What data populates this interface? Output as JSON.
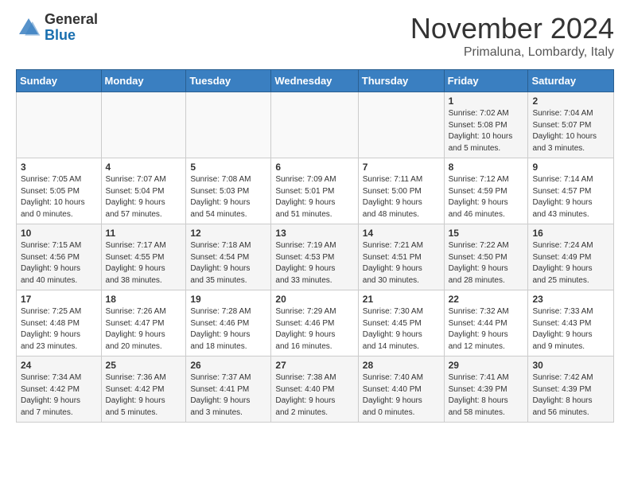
{
  "header": {
    "logo_general": "General",
    "logo_blue": "Blue",
    "month_year": "November 2024",
    "location": "Primaluna, Lombardy, Italy"
  },
  "weekdays": [
    "Sunday",
    "Monday",
    "Tuesday",
    "Wednesday",
    "Thursday",
    "Friday",
    "Saturday"
  ],
  "weeks": [
    [
      {
        "day": "",
        "info": ""
      },
      {
        "day": "",
        "info": ""
      },
      {
        "day": "",
        "info": ""
      },
      {
        "day": "",
        "info": ""
      },
      {
        "day": "",
        "info": ""
      },
      {
        "day": "1",
        "info": "Sunrise: 7:02 AM\nSunset: 5:08 PM\nDaylight: 10 hours\nand 5 minutes."
      },
      {
        "day": "2",
        "info": "Sunrise: 7:04 AM\nSunset: 5:07 PM\nDaylight: 10 hours\nand 3 minutes."
      }
    ],
    [
      {
        "day": "3",
        "info": "Sunrise: 7:05 AM\nSunset: 5:05 PM\nDaylight: 10 hours\nand 0 minutes."
      },
      {
        "day": "4",
        "info": "Sunrise: 7:07 AM\nSunset: 5:04 PM\nDaylight: 9 hours\nand 57 minutes."
      },
      {
        "day": "5",
        "info": "Sunrise: 7:08 AM\nSunset: 5:03 PM\nDaylight: 9 hours\nand 54 minutes."
      },
      {
        "day": "6",
        "info": "Sunrise: 7:09 AM\nSunset: 5:01 PM\nDaylight: 9 hours\nand 51 minutes."
      },
      {
        "day": "7",
        "info": "Sunrise: 7:11 AM\nSunset: 5:00 PM\nDaylight: 9 hours\nand 48 minutes."
      },
      {
        "day": "8",
        "info": "Sunrise: 7:12 AM\nSunset: 4:59 PM\nDaylight: 9 hours\nand 46 minutes."
      },
      {
        "day": "9",
        "info": "Sunrise: 7:14 AM\nSunset: 4:57 PM\nDaylight: 9 hours\nand 43 minutes."
      }
    ],
    [
      {
        "day": "10",
        "info": "Sunrise: 7:15 AM\nSunset: 4:56 PM\nDaylight: 9 hours\nand 40 minutes."
      },
      {
        "day": "11",
        "info": "Sunrise: 7:17 AM\nSunset: 4:55 PM\nDaylight: 9 hours\nand 38 minutes."
      },
      {
        "day": "12",
        "info": "Sunrise: 7:18 AM\nSunset: 4:54 PM\nDaylight: 9 hours\nand 35 minutes."
      },
      {
        "day": "13",
        "info": "Sunrise: 7:19 AM\nSunset: 4:53 PM\nDaylight: 9 hours\nand 33 minutes."
      },
      {
        "day": "14",
        "info": "Sunrise: 7:21 AM\nSunset: 4:51 PM\nDaylight: 9 hours\nand 30 minutes."
      },
      {
        "day": "15",
        "info": "Sunrise: 7:22 AM\nSunset: 4:50 PM\nDaylight: 9 hours\nand 28 minutes."
      },
      {
        "day": "16",
        "info": "Sunrise: 7:24 AM\nSunset: 4:49 PM\nDaylight: 9 hours\nand 25 minutes."
      }
    ],
    [
      {
        "day": "17",
        "info": "Sunrise: 7:25 AM\nSunset: 4:48 PM\nDaylight: 9 hours\nand 23 minutes."
      },
      {
        "day": "18",
        "info": "Sunrise: 7:26 AM\nSunset: 4:47 PM\nDaylight: 9 hours\nand 20 minutes."
      },
      {
        "day": "19",
        "info": "Sunrise: 7:28 AM\nSunset: 4:46 PM\nDaylight: 9 hours\nand 18 minutes."
      },
      {
        "day": "20",
        "info": "Sunrise: 7:29 AM\nSunset: 4:46 PM\nDaylight: 9 hours\nand 16 minutes."
      },
      {
        "day": "21",
        "info": "Sunrise: 7:30 AM\nSunset: 4:45 PM\nDaylight: 9 hours\nand 14 minutes."
      },
      {
        "day": "22",
        "info": "Sunrise: 7:32 AM\nSunset: 4:44 PM\nDaylight: 9 hours\nand 12 minutes."
      },
      {
        "day": "23",
        "info": "Sunrise: 7:33 AM\nSunset: 4:43 PM\nDaylight: 9 hours\nand 9 minutes."
      }
    ],
    [
      {
        "day": "24",
        "info": "Sunrise: 7:34 AM\nSunset: 4:42 PM\nDaylight: 9 hours\nand 7 minutes."
      },
      {
        "day": "25",
        "info": "Sunrise: 7:36 AM\nSunset: 4:42 PM\nDaylight: 9 hours\nand 5 minutes."
      },
      {
        "day": "26",
        "info": "Sunrise: 7:37 AM\nSunset: 4:41 PM\nDaylight: 9 hours\nand 3 minutes."
      },
      {
        "day": "27",
        "info": "Sunrise: 7:38 AM\nSunset: 4:40 PM\nDaylight: 9 hours\nand 2 minutes."
      },
      {
        "day": "28",
        "info": "Sunrise: 7:40 AM\nSunset: 4:40 PM\nDaylight: 9 hours\nand 0 minutes."
      },
      {
        "day": "29",
        "info": "Sunrise: 7:41 AM\nSunset: 4:39 PM\nDaylight: 8 hours\nand 58 minutes."
      },
      {
        "day": "30",
        "info": "Sunrise: 7:42 AM\nSunset: 4:39 PM\nDaylight: 8 hours\nand 56 minutes."
      }
    ]
  ]
}
